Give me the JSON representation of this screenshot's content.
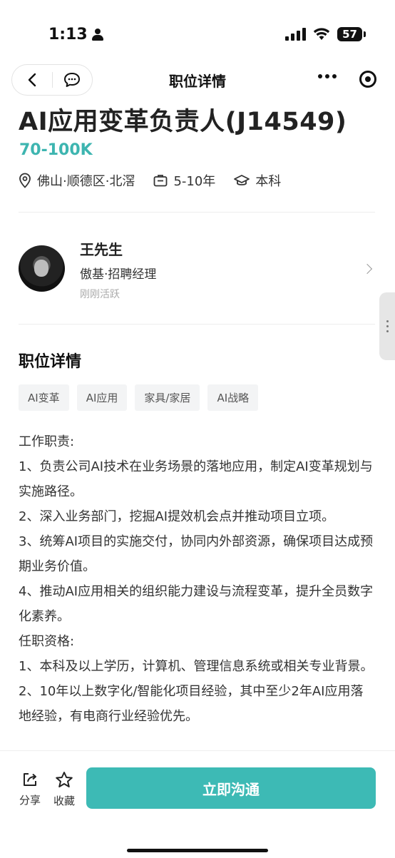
{
  "status_bar": {
    "time": "1:13",
    "battery": "57"
  },
  "nav": {
    "title": "职位详情"
  },
  "job": {
    "title": "AI应用变革负责人(J14549)",
    "salary": "70-100K",
    "location": "佛山·顺德区·北滘",
    "experience": "5-10年",
    "education": "本科"
  },
  "recruiter": {
    "name": "王先生",
    "company_role": "傲基·招聘经理",
    "active_status": "刚刚活跃"
  },
  "details": {
    "section_title": "职位详情",
    "tags": [
      "AI变革",
      "AI应用",
      "家具/家居",
      "AI战略"
    ],
    "lines": [
      "工作职责:",
      "1、负责公司AI技术在业务场景的落地应用，制定AI变革规划与实施路径。",
      "2、深入业务部门，挖掘AI提效机会点并推动项目立项。",
      "3、统筹AI项目的实施交付，协同内外部资源，确保项目达成预期业务价值。",
      "4、推动AI应用相关的组织能力建设与流程变革，提升全员数字化素养。",
      "任职资格:",
      "1、本科及以上学历，计算机、管理信息系统或相关专业背景。",
      "2、10年以上数字化/智能化项目经验，其中至少2年AI应用落地经验，有电商行业经验优先。"
    ]
  },
  "bottom_bar": {
    "share_label": "分享",
    "favorite_label": "收藏",
    "cta_label": "立即沟通"
  },
  "colors": {
    "accent": "#3dbab5",
    "salary": "#3db5b0"
  }
}
